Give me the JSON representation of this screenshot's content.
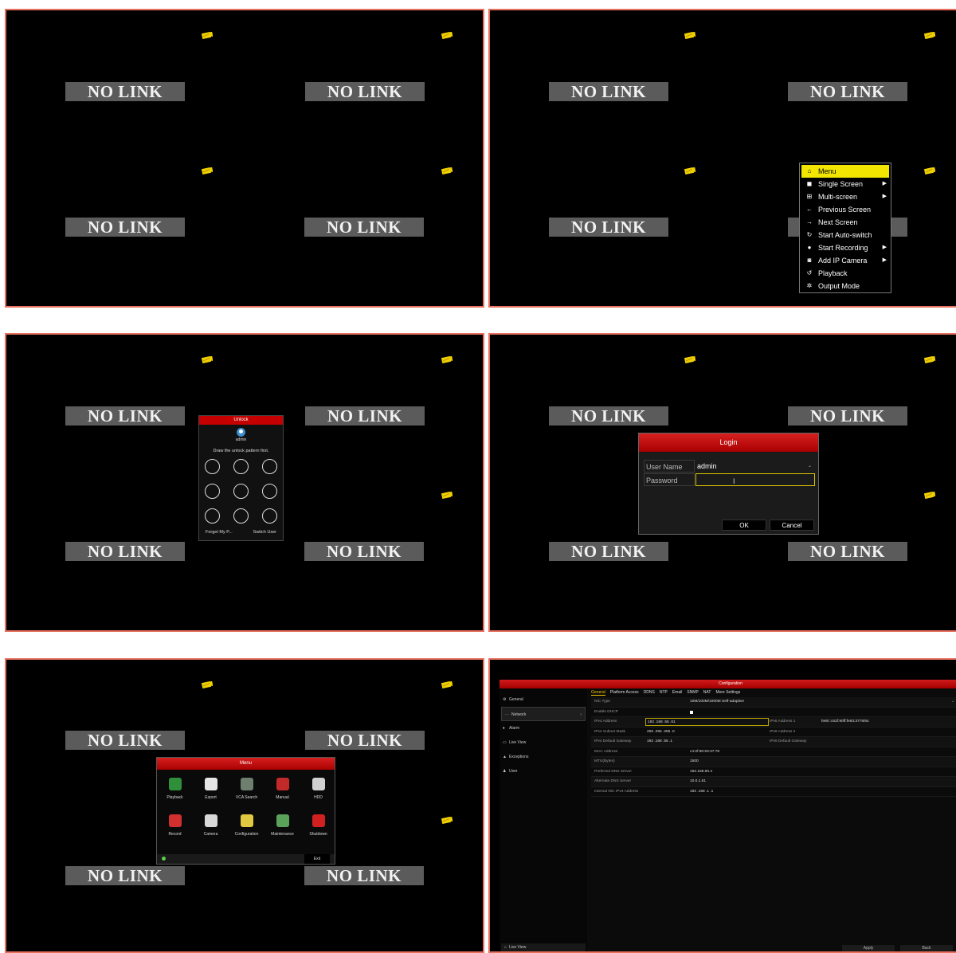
{
  "no_link_label": "NO LINK",
  "context_menu": {
    "items": [
      {
        "label": "Menu",
        "icon": "home-icon",
        "glyph": "⌂",
        "submenu": false,
        "selected": true
      },
      {
        "label": "Single Screen",
        "icon": "single-screen-icon",
        "glyph": "◼",
        "submenu": true,
        "selected": false
      },
      {
        "label": "Multi-screen",
        "icon": "multi-screen-icon",
        "glyph": "⊞",
        "submenu": true,
        "selected": false
      },
      {
        "label": "Previous Screen",
        "icon": "arrow-left-icon",
        "glyph": "←",
        "submenu": false,
        "selected": false
      },
      {
        "label": "Next Screen",
        "icon": "arrow-right-icon",
        "glyph": "→",
        "submenu": false,
        "selected": false
      },
      {
        "label": "Start Auto-switch",
        "icon": "auto-switch-icon",
        "glyph": "↻",
        "submenu": false,
        "selected": false
      },
      {
        "label": "Start Recording",
        "icon": "recording-icon",
        "glyph": "●",
        "submenu": true,
        "selected": false
      },
      {
        "label": "Add IP Camera",
        "icon": "camera-add-icon",
        "glyph": "◙",
        "submenu": true,
        "selected": false
      },
      {
        "label": "Playback",
        "icon": "playback-icon",
        "glyph": "↺",
        "submenu": false,
        "selected": false
      },
      {
        "label": "Output Mode",
        "icon": "output-mode-icon",
        "glyph": "✲",
        "submenu": false,
        "selected": false
      }
    ]
  },
  "unlock": {
    "title": "Unlock",
    "user": "admin",
    "hint": "Draw the unlock pattern first.",
    "forgot": "Forget My P...",
    "switch_user": "Switch User"
  },
  "login": {
    "title": "Login",
    "username_label": "User Name",
    "username_value": "admin",
    "password_label": "Password",
    "password_value": "",
    "ok": "OK",
    "cancel": "Cancel"
  },
  "main_menu": {
    "title": "Menu",
    "items": [
      {
        "label": "Playback",
        "icon": "playback-icon",
        "color": "#2f8f3a"
      },
      {
        "label": "Export",
        "icon": "export-icon",
        "color": "#e6e6e6"
      },
      {
        "label": "VCA Search",
        "icon": "vca-search-icon",
        "color": "#6f7f6f"
      },
      {
        "label": "Manual",
        "icon": "manual-record-icon",
        "color": "#c22a2a"
      },
      {
        "label": "HDD",
        "icon": "hdd-icon",
        "color": "#d0d0d0"
      },
      {
        "label": "Record",
        "icon": "record-icon",
        "color": "#d23030"
      },
      {
        "label": "Camera",
        "icon": "camera-icon",
        "color": "#d8d8d8"
      },
      {
        "label": "Configuration",
        "icon": "configuration-icon",
        "color": "#e0c840"
      },
      {
        "label": "Maintenance",
        "icon": "maintenance-icon",
        "color": "#5aa25a"
      },
      {
        "label": "Shutdown",
        "icon": "shutdown-icon",
        "color": "#d02020"
      }
    ],
    "exit": "Exit"
  },
  "configuration": {
    "title": "Configuration",
    "sidebar": [
      {
        "label": "General",
        "icon": "gear-icon",
        "glyph": "⚙",
        "selected": false
      },
      {
        "label": "Network",
        "icon": "network-icon",
        "glyph": "⋯",
        "selected": true
      },
      {
        "label": "Alarm",
        "icon": "alarm-icon",
        "glyph": "♦",
        "selected": false
      },
      {
        "label": "Live View",
        "icon": "live-view-icon",
        "glyph": "▭",
        "selected": false
      },
      {
        "label": "Exceptions",
        "icon": "warning-icon",
        "glyph": "▲",
        "selected": false
      },
      {
        "label": "User",
        "icon": "user-icon",
        "glyph": "♟",
        "selected": false
      }
    ],
    "sidebar_bottom": "Live View",
    "tabs": [
      "General",
      "Platform Access",
      "DDNS",
      "NTP",
      "Email",
      "SNMP",
      "NAT",
      "More Settings"
    ],
    "active_tab": 0,
    "rows": {
      "nic_type_label": "NIC Type",
      "nic_type_value": "10M/100M/1000M Self-adaptive",
      "dhcp_label": "Enable DHCP",
      "ipv4_label": "IPv4 Address",
      "ipv4_value": "192 .168 .55  .61",
      "ipv6_1_label": "IPv6 Address 1",
      "ipv6_1_value": "fe80::c62f:90ff:fe93:3778/64",
      "mask_label": "IPv4 Subnet Mask",
      "mask_value": "255 .255 .255 .0",
      "ipv6_2_label": "IPv6 Address 2",
      "gateway_label": "IPv4 Default Gateway",
      "gateway_value": "192 .168 .55  .1",
      "ipv6_gateway_label": "IPv6 Default Gateway",
      "mac_label": "MAC Address",
      "mac_value": "c4:2f:90:93:37:78",
      "mtu_label": "MTU(Bytes)",
      "mtu_value": "1500",
      "dns1_label": "Preferred DNS Server",
      "dns1_value": "192.168.60.4",
      "dns2_label": "Alternate DNS Server",
      "dns2_value": "10.0.1.61",
      "internal_label": "Internal NIC IPv4 Address",
      "internal_value": "192 .168 .1    .1"
    },
    "apply": "Apply",
    "back": "Back"
  }
}
